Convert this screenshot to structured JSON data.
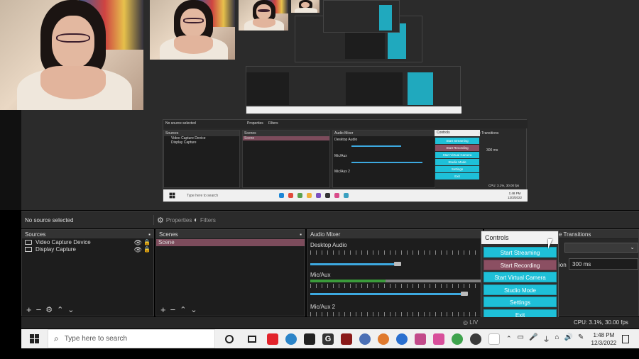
{
  "obs": {
    "no_source_selected": "No source selected",
    "properties_label": "Properties",
    "filters_label": "Filters",
    "sources_header": "Sources",
    "scenes_header": "Scenes",
    "audio_mixer_header": "Audio Mixer",
    "transitions_header": "e Transitions",
    "sources": [
      "Video Capture Device",
      "Display Capture"
    ],
    "scenes": [
      "Scene"
    ],
    "audio_channels": [
      "Desktop Audio",
      "Mic/Aux",
      "Mic/Aux 2"
    ],
    "duration_label": "ion",
    "duration_value": "300 ms",
    "controls_title": "Controls",
    "controls_buttons": [
      "Start Streaming",
      "Start Recording",
      "Start Virtual Camera",
      "Studio Mode",
      "Settings",
      "Exit"
    ],
    "status_live": "LIV",
    "status_cpu": "CPU: 3.1%, 30.00 fps"
  },
  "taskbar": {
    "search_placeholder": "Type here to search",
    "time": "1:48 PM",
    "date": "12/3/2022"
  },
  "nested": {
    "no_source_selected": "No source selected",
    "properties": "Properties",
    "filters": "Filters",
    "sources": "Sources",
    "scenes": "Scenes",
    "audio_mixer": "Audio Mixer",
    "transitions": "e Transitions",
    "source_items": [
      "Video Capture Device",
      "Display Capture"
    ],
    "scene_item": "Scene",
    "desktop_audio": "Desktop Audio",
    "mic_aux": "Mic/Aux",
    "mic_aux2": "Mic/Aux 2",
    "duration": "300 ms",
    "controls": "Controls",
    "buttons": [
      "Start Streaming",
      "Start Recording",
      "Start Virtual Camera",
      "Studio Mode",
      "Settings",
      "Exit"
    ],
    "search": "Type here to search",
    "cpu": "CPU: 3.1%, 30.00 fps",
    "time": "1:48 PM",
    "date": "12/3/2022"
  },
  "colors": {
    "accent_cyan": "#1ec0d8",
    "record_button": "#8b4f62",
    "selected_scene": "#7d4c5c",
    "panel_bg": "#1d1d1d"
  },
  "icons": [
    "eye-icon",
    "lock-icon",
    "gear-icon",
    "plus-icon",
    "minus-icon",
    "arrow-up-icon",
    "arrow-down-icon",
    "windows-start-icon",
    "search-icon",
    "cortana-icon",
    "task-view-icon"
  ]
}
